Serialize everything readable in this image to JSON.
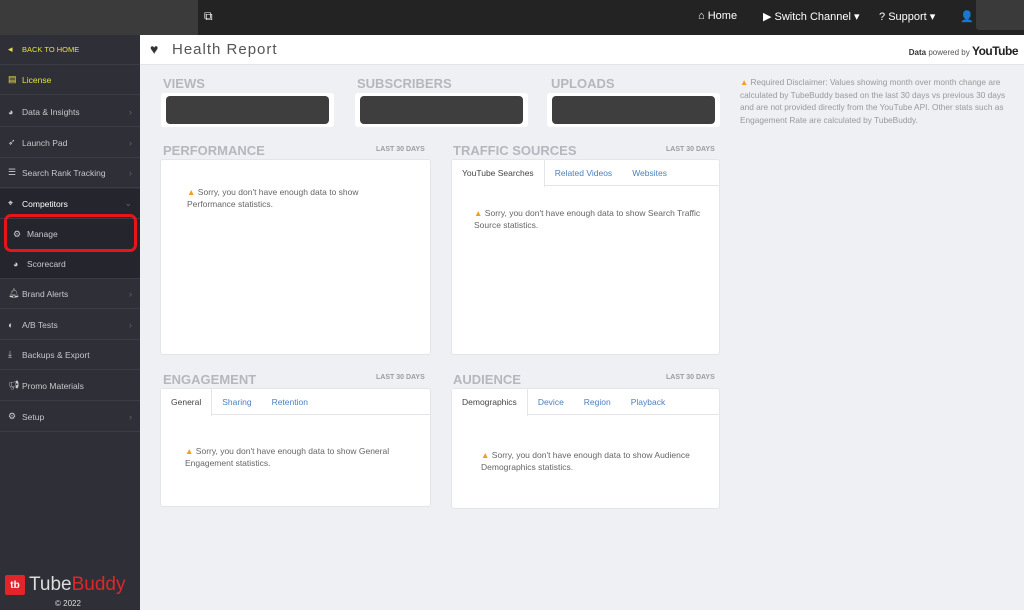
{
  "topbar": {
    "home": "Home",
    "switch_channel": "Switch Channel",
    "support": "Support"
  },
  "sidebar": {
    "back": "BACK TO HOME",
    "items": [
      "License",
      "Data & Insights",
      "Launch Pad",
      "Search Rank Tracking",
      "Competitors",
      "Manage",
      "Scorecard",
      "Brand Alerts",
      "A/B Tests",
      "Backups & Export",
      "Promo Materials",
      "Setup"
    ],
    "logo_a": "Tube",
    "logo_b": "Buddy",
    "copyright": "© 2022"
  },
  "header": {
    "title": "Health Report",
    "data": "Data",
    "powered": "powered by",
    "youtube": "YouTube"
  },
  "stats": {
    "views": "VIEWS",
    "subscribers": "SUBSCRIBERS",
    "uploads": "UPLOADS"
  },
  "disclaimer": "Required Disclaimer: Values showing month over month change are calculated by TubeBuddy based on the last 30 days vs previous 30 days and are not provided directly from the YouTube API. Other stats such as Engagement Rate are calculated by TubeBuddy.",
  "last30": "LAST 30 DAYS",
  "performance": {
    "title": "PERFORMANCE",
    "msg": "Sorry, you don't have enough data to show Performance statistics."
  },
  "traffic": {
    "title": "TRAFFIC SOURCES",
    "tabs": [
      "YouTube Searches",
      "Related Videos",
      "Websites"
    ],
    "msg": "Sorry, you don't have enough data to show Search Traffic Source statistics."
  },
  "engagement": {
    "title": "ENGAGEMENT",
    "tabs": [
      "General",
      "Sharing",
      "Retention"
    ],
    "msg": "Sorry, you don't have enough data to show General Engagement statistics."
  },
  "audience": {
    "title": "AUDIENCE",
    "tabs": [
      "Demographics",
      "Device",
      "Region",
      "Playback"
    ],
    "msg": "Sorry, you don't have enough data to show Audience Demographics statistics."
  }
}
